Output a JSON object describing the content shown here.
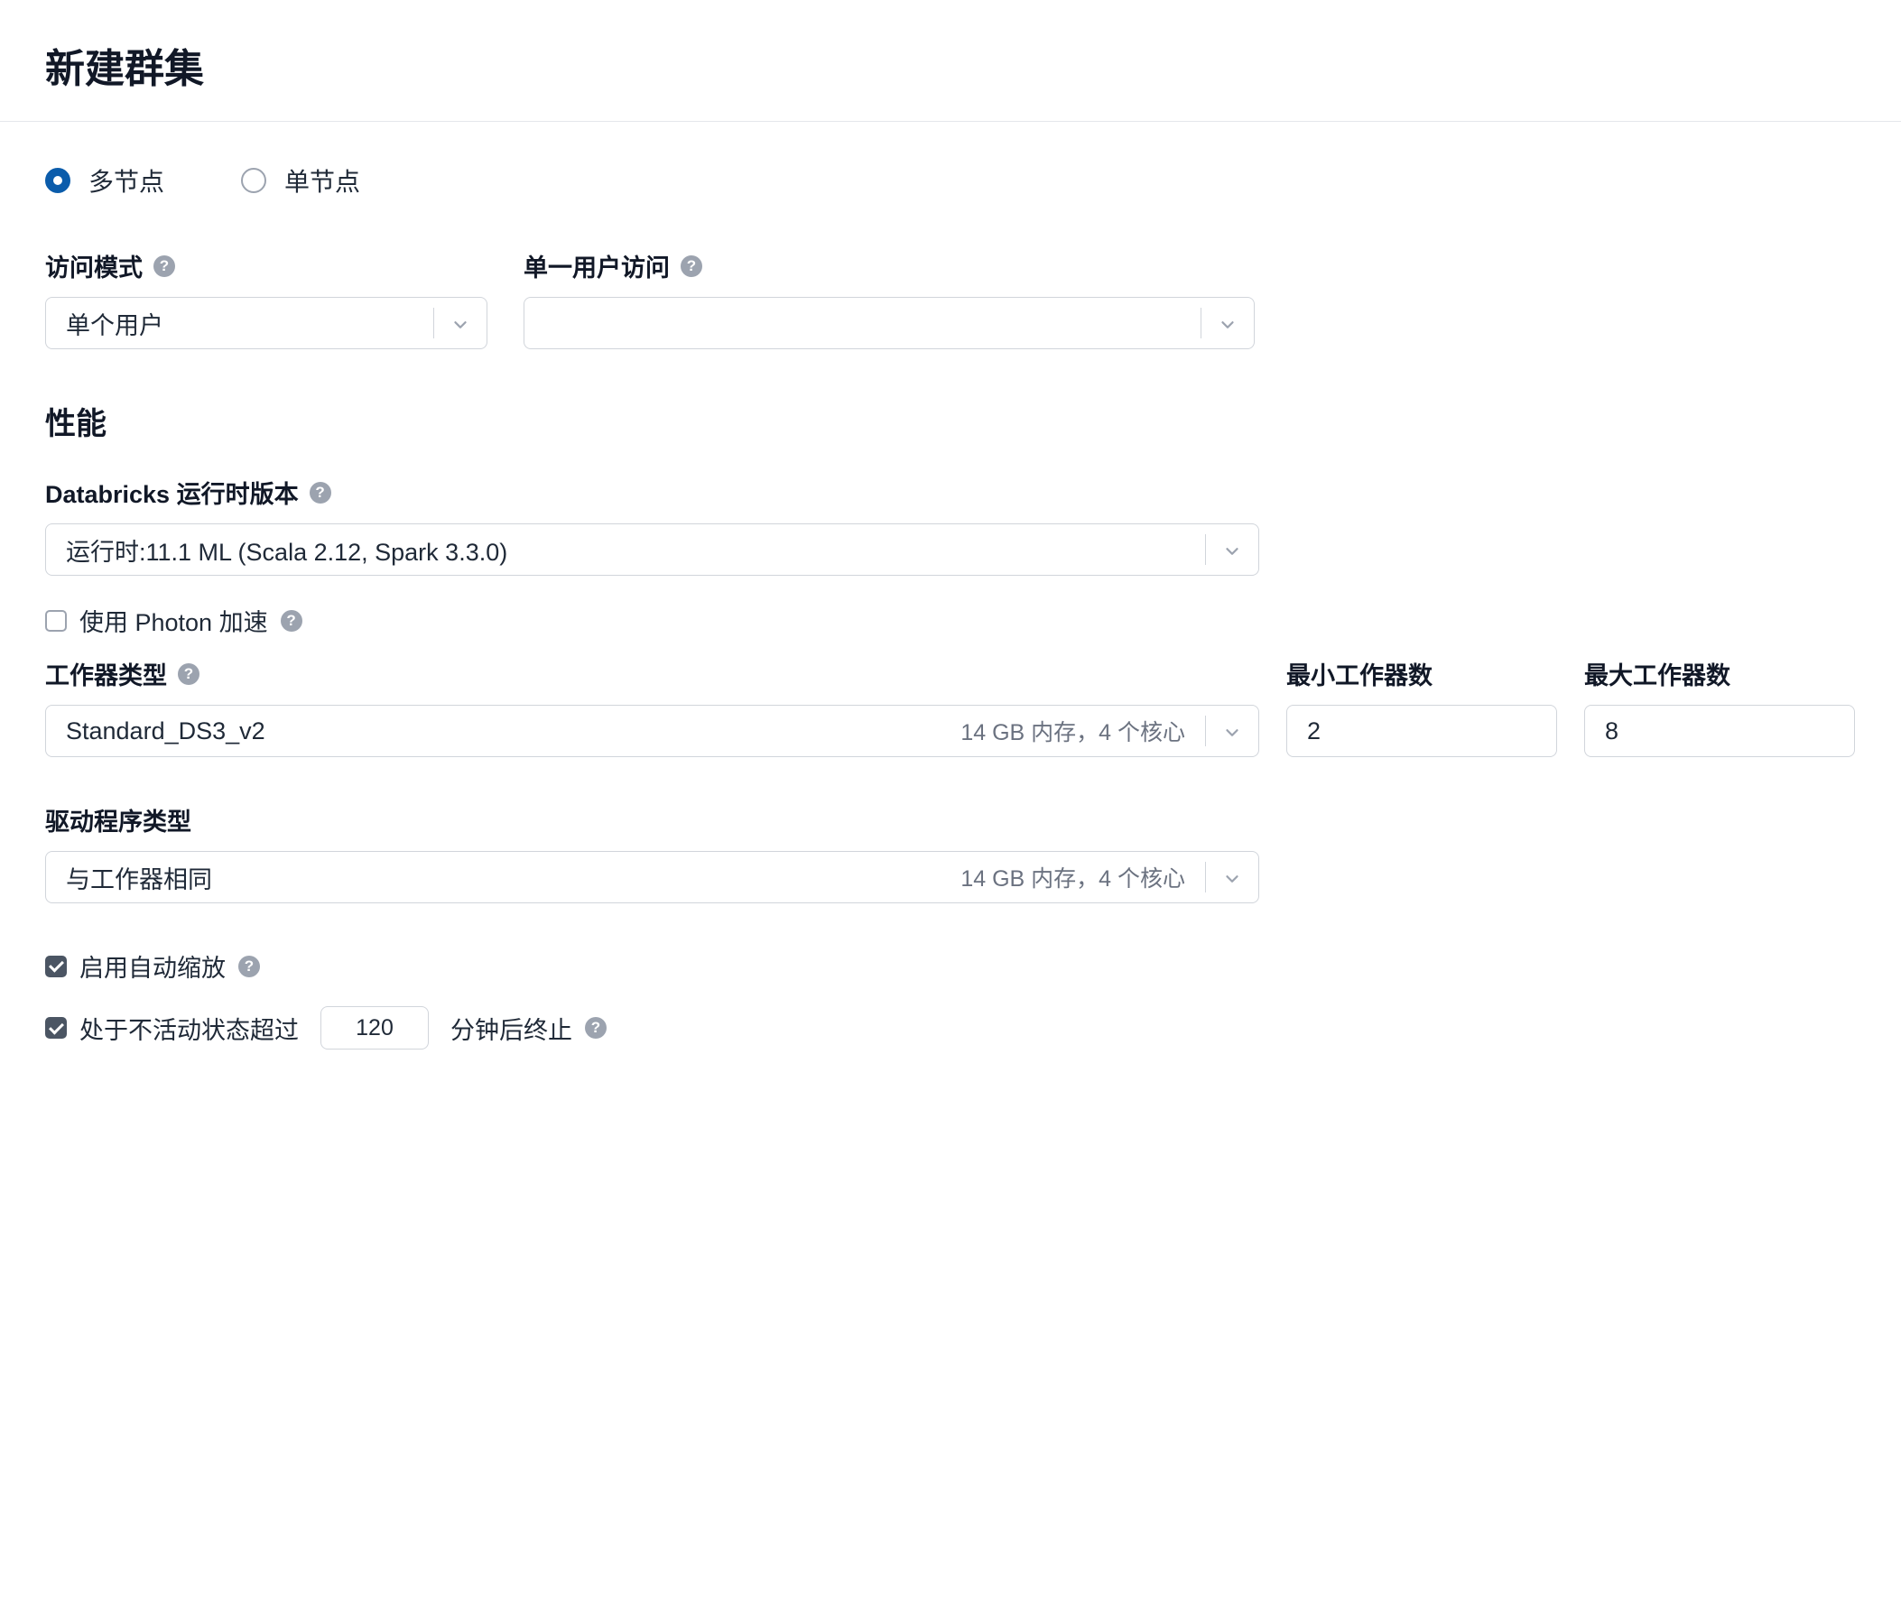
{
  "page_title": "新建群集",
  "node_mode": {
    "multi_label": "多节点",
    "single_label": "单节点",
    "selected": "multi"
  },
  "access_mode": {
    "label": "访问模式",
    "value": "单个用户"
  },
  "single_user_access": {
    "label": "单一用户访问",
    "value": ""
  },
  "performance": {
    "section_title": "性能",
    "runtime_label": "Databricks 运行时版本",
    "runtime_value": "运行时:11.1 ML (Scala 2.12, Spark 3.3.0)",
    "photon_label": "使用 Photon 加速",
    "photon_checked": false,
    "worker_type_label": "工作器类型",
    "worker_type_value": "Standard_DS3_v2",
    "worker_type_meta": "14 GB 内存，4 个核心",
    "min_workers_label": "最小工作器数",
    "min_workers_value": "2",
    "max_workers_label": "最大工作器数",
    "max_workers_value": "8",
    "driver_type_label": "驱动程序类型",
    "driver_type_value": "与工作器相同",
    "driver_type_meta": "14 GB 内存，4 个核心",
    "autoscale_label": "启用自动缩放",
    "autoscale_checked": true,
    "terminate_prefix": "处于不活动状态超过",
    "terminate_minutes": "120",
    "terminate_suffix": "分钟后终止",
    "terminate_checked": true
  }
}
